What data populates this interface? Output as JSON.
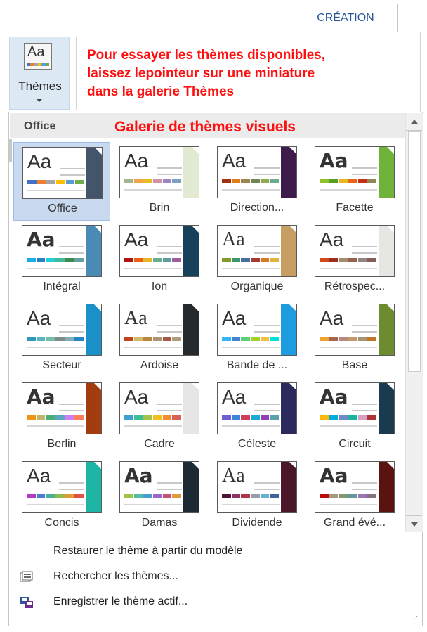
{
  "ribbon": {
    "tab_label": "CRÉATION",
    "themes_button": {
      "label": "Thèmes",
      "icon_text": "Aa"
    }
  },
  "annotation": {
    "lines": [
      "Pour essayer les thèmes disponibles,",
      "laissez lepointeur sur une miniature",
      "dans la galerie Thèmes"
    ]
  },
  "gallery": {
    "section_label": "Office",
    "caption": "Galerie de thèmes visuels",
    "themes": [
      {
        "name": "Office",
        "selected": true,
        "aa": "Aa",
        "font": "sans",
        "accent": "#44546a",
        "colors": [
          "#4472c4",
          "#ed7d31",
          "#a5a5a5",
          "#ffc000",
          "#5b9bd5",
          "#70ad47"
        ]
      },
      {
        "name": "Brin",
        "aa": "Aa",
        "font": "sans",
        "accent": "#e2ead1",
        "colors": [
          "#a5b592",
          "#f3a447",
          "#e7bc29",
          "#d092a7",
          "#9c85c0",
          "#809ec2"
        ]
      },
      {
        "name": "Direction...",
        "aa": "Aa",
        "font": "sans",
        "accent": "#3d1b4a",
        "colors": [
          "#a53010",
          "#de7e18",
          "#9f8351",
          "#728653",
          "#92aa4c",
          "#6aac91"
        ]
      },
      {
        "name": "Facette",
        "aa": "Aa",
        "font": "bold",
        "accent": "#6fb33b",
        "colors": [
          "#90c226",
          "#54a021",
          "#e6b91e",
          "#e76618",
          "#c42f1a",
          "#918655"
        ]
      },
      {
        "name": "Intégral",
        "aa": "Aa",
        "font": "bold",
        "accent": "#4a8bb5",
        "colors": [
          "#1cade4",
          "#2683c6",
          "#27ced7",
          "#42ba97",
          "#3e8853",
          "#62a39f"
        ]
      },
      {
        "name": "Ion",
        "aa": "Aa",
        "font": "sans",
        "accent": "#17405a",
        "colors": [
          "#b01513",
          "#ea6312",
          "#e6b729",
          "#6aac90",
          "#5f9c9d",
          "#9e5e9b"
        ]
      },
      {
        "name": "Organique",
        "aa": "Aa",
        "font": "serif",
        "accent": "#c89f63",
        "colors": [
          "#83992a",
          "#3c9770",
          "#44709d",
          "#a23c33",
          "#d97828",
          "#deb340"
        ]
      },
      {
        "name": "Rétrospec...",
        "aa": "Aa",
        "font": "sans",
        "accent": "#e8e6e2",
        "colors": [
          "#d34817",
          "#9b2d1f",
          "#a28e6a",
          "#956251",
          "#918485",
          "#855d5d"
        ]
      },
      {
        "name": "Secteur",
        "aa": "Aa",
        "font": "sans",
        "accent": "#1b8fc7",
        "colors": [
          "#3494ba",
          "#58b6c0",
          "#75bda7",
          "#7a8c8e",
          "#84acb6",
          "#2683c6"
        ]
      },
      {
        "name": "Ardoise",
        "aa": "Aa",
        "font": "serif",
        "accent": "#262a2e",
        "colors": [
          "#bc451b",
          "#d3ba68",
          "#bb8640",
          "#ad9277",
          "#a55a43",
          "#ad9d7b"
        ]
      },
      {
        "name": "Bande de ...",
        "aa": "Aa",
        "font": "sans",
        "accent": "#1e9ce0",
        "colors": [
          "#31b6fd",
          "#4584d3",
          "#5bd078",
          "#a5d028",
          "#f5c040",
          "#05e0db"
        ]
      },
      {
        "name": "Base",
        "aa": "Aa",
        "font": "sans",
        "accent": "#6e8b30",
        "colors": [
          "#f0a22e",
          "#a5644e",
          "#b58b80",
          "#c3986d",
          "#a19574",
          "#c17529"
        ]
      },
      {
        "name": "Berlin",
        "aa": "Aa",
        "font": "bold",
        "accent": "#a33c0f",
        "colors": [
          "#f09415",
          "#c1b56b",
          "#4baf73",
          "#5aa6c0",
          "#d17df9",
          "#fa7e5c"
        ]
      },
      {
        "name": "Cadre",
        "aa": "Aa",
        "font": "sans",
        "accent": "#e6e6e6",
        "colors": [
          "#40a1d1",
          "#39bf9c",
          "#a4c24f",
          "#f0c11b",
          "#f28d2c",
          "#d76158"
        ]
      },
      {
        "name": "Céleste",
        "aa": "Aa",
        "font": "sans",
        "accent": "#2b2a5c",
        "colors": [
          "#6c5fd5",
          "#3b86d9",
          "#d03d5a",
          "#1aabd3",
          "#8e3fb9",
          "#5aa2ae"
        ]
      },
      {
        "name": "Circuit",
        "aa": "Aa",
        "font": "bold",
        "accent": "#1a3a50",
        "colors": [
          "#feb80a",
          "#00addc",
          "#738ac8",
          "#1ab39f",
          "#d5a1c3",
          "#ae3336"
        ]
      },
      {
        "name": "Concis",
        "aa": "Aa",
        "font": "sans",
        "accent": "#1fb5a4",
        "colors": [
          "#ac3ec1",
          "#477bd1",
          "#46b298",
          "#90ba4c",
          "#dd9d31",
          "#e25247"
        ]
      },
      {
        "name": "Damas",
        "aa": "Aa",
        "font": "bold",
        "accent": "#1d2a34",
        "colors": [
          "#9ec544",
          "#50bea3",
          "#4a9ccc",
          "#9a66ca",
          "#c54f71",
          "#de9c3c"
        ]
      },
      {
        "name": "Dividende",
        "aa": "Aa",
        "font": "serif",
        "accent": "#4a1629",
        "colors": [
          "#4d1434",
          "#903163",
          "#b2324b",
          "#969fa7",
          "#66b1ce",
          "#40619d"
        ]
      },
      {
        "name": "Grand évé...",
        "aa": "Aa",
        "font": "heavy",
        "accent": "#5a1410",
        "colors": [
          "#b80e0f",
          "#a6987d",
          "#7f9a71",
          "#64969f",
          "#9b75b2",
          "#80737a"
        ]
      }
    ]
  },
  "menu": {
    "items": [
      {
        "label": "Restaurer le thème à partir du modèle",
        "icon": "none"
      },
      {
        "label": "Rechercher les thèmes...",
        "icon": "browse-folder-icon"
      },
      {
        "label": "Enregistrer le thème actif...",
        "icon": "save-theme-icon"
      }
    ]
  },
  "colors": {
    "annotation": "#ff1010",
    "tab_text": "#2b579a",
    "selection": "#c9daf0"
  }
}
